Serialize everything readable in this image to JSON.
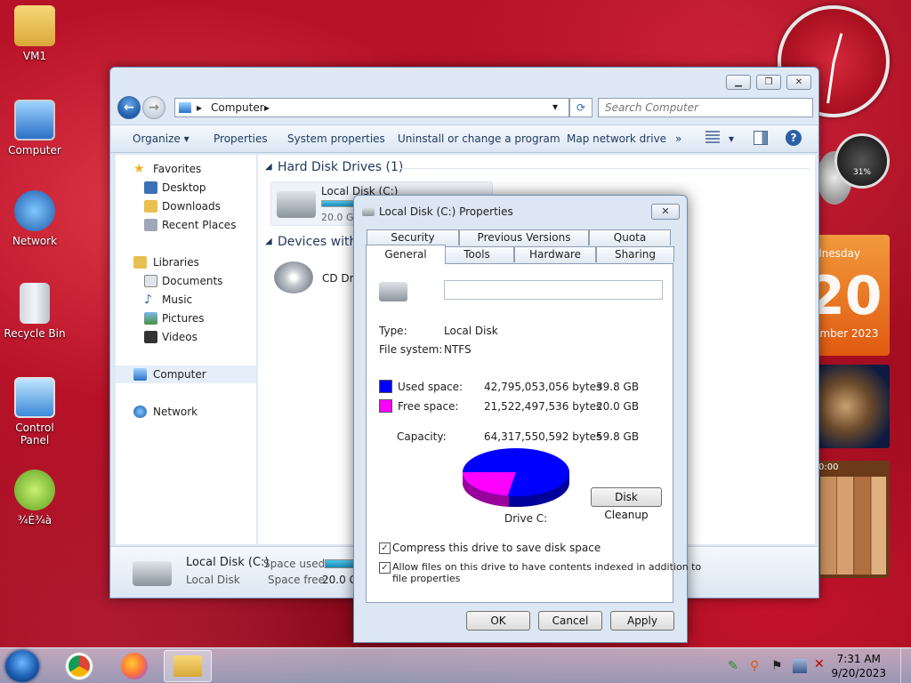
{
  "desktop": {
    "icons": [
      {
        "label": "VM1"
      },
      {
        "label": "Computer"
      },
      {
        "label": "Network"
      },
      {
        "label": "Recycle Bin"
      },
      {
        "label": "Control Panel"
      },
      {
        "label": "¾É¾à"
      }
    ]
  },
  "gadgets": {
    "gauge_value": "31%",
    "calendar_day": "dnesday",
    "calendar_num": "20",
    "calendar_month": "ember 2023",
    "puzzle_time": "0:00"
  },
  "explorer": {
    "breadcrumb": "Computer",
    "search_placeholder": "Search Computer",
    "toolbar": {
      "organize": "Organize ▾",
      "properties": "Properties",
      "system_properties": "System properties",
      "uninstall": "Uninstall or change a program",
      "map_drive": "Map network drive",
      "more": "»"
    },
    "sidebar": {
      "favorites": "Favorites",
      "desktop": "Desktop",
      "downloads": "Downloads",
      "recent": "Recent Places",
      "libraries": "Libraries",
      "documents": "Documents",
      "music": "Music",
      "pictures": "Pictures",
      "videos": "Videos",
      "computer": "Computer",
      "network": "Network"
    },
    "groups": {
      "hdd": "Hard Disk Drives (1)",
      "devices": "Devices with"
    },
    "drive_c": {
      "name": "Local Disk (C:)",
      "free_short": "20.0 G"
    },
    "cd_drive": "CD Driv",
    "status": {
      "name": "Local Disk (C:)",
      "type": "Local Disk",
      "space_used_label": "Space used:",
      "space_free_label": "Space free:",
      "space_free_value": "20.0 GB"
    }
  },
  "dialog": {
    "title": "Local Disk (C:) Properties",
    "tabs": {
      "security": "Security",
      "previous_versions": "Previous Versions",
      "quota": "Quota",
      "general": "General",
      "tools": "Tools",
      "hardware": "Hardware",
      "sharing": "Sharing"
    },
    "type_label": "Type:",
    "type_value": "Local Disk",
    "fs_label": "File system:",
    "fs_value": "NTFS",
    "used_label": "Used space:",
    "used_bytes": "42,795,053,056 bytes",
    "used_gb": "39.8 GB",
    "free_label": "Free space:",
    "free_bytes": "21,522,497,536 bytes",
    "free_gb": "20.0 GB",
    "capacity_label": "Capacity:",
    "capacity_bytes": "64,317,550,592 bytes",
    "capacity_gb": "59.8 GB",
    "drive_label": "Drive C:",
    "disk_cleanup": "Disk Cleanup",
    "compress_label": "Compress this drive to save disk space",
    "index_label_1": "Allow files on this drive to have contents indexed in addition to",
    "index_label_2": "file properties",
    "ok": "OK",
    "cancel": "Cancel",
    "apply": "Apply",
    "colors": {
      "used": "#0000ff",
      "free": "#ff00ff"
    },
    "used_fraction": 0.665
  },
  "taskbar": {
    "time": "7:31 AM",
    "date": "9/20/2023"
  }
}
